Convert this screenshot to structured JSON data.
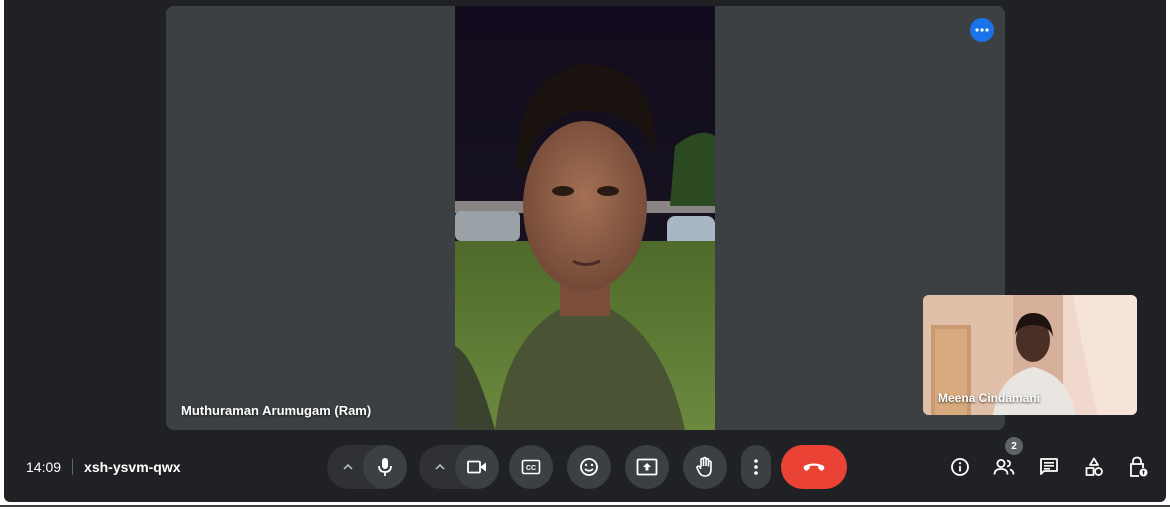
{
  "meeting": {
    "time": "14:09",
    "code": "xsh-ysvm-qwx"
  },
  "main_tile": {
    "participant_name": "Muthuraman Arumugam (Ram)",
    "more_options_icon": "more-horiz-icon"
  },
  "self_tile": {
    "participant_name": "Meena Cindamani"
  },
  "controls": {
    "audio_options_icon": "chevron-up-icon",
    "microphone_icon": "microphone-icon",
    "video_options_icon": "chevron-up-icon",
    "camera_icon": "videocam-icon",
    "captions_icon": "closed-captions-icon",
    "reactions_icon": "emoji-icon",
    "present_icon": "present-screen-icon",
    "raise_hand_icon": "hand-icon",
    "more_icon": "more-vert-icon",
    "end_call_icon": "call-end-icon"
  },
  "right_panel": {
    "info_icon": "info-icon",
    "people_icon": "people-icon",
    "people_count": "2",
    "chat_icon": "chat-icon",
    "activities_icon": "activities-icon",
    "host_controls_icon": "lock-person-icon"
  },
  "colors": {
    "background": "#202124",
    "tile": "#3c4043",
    "button": "#3c4043",
    "end_call": "#ea4335",
    "accent": "#1a73e8",
    "text": "#ffffff"
  }
}
